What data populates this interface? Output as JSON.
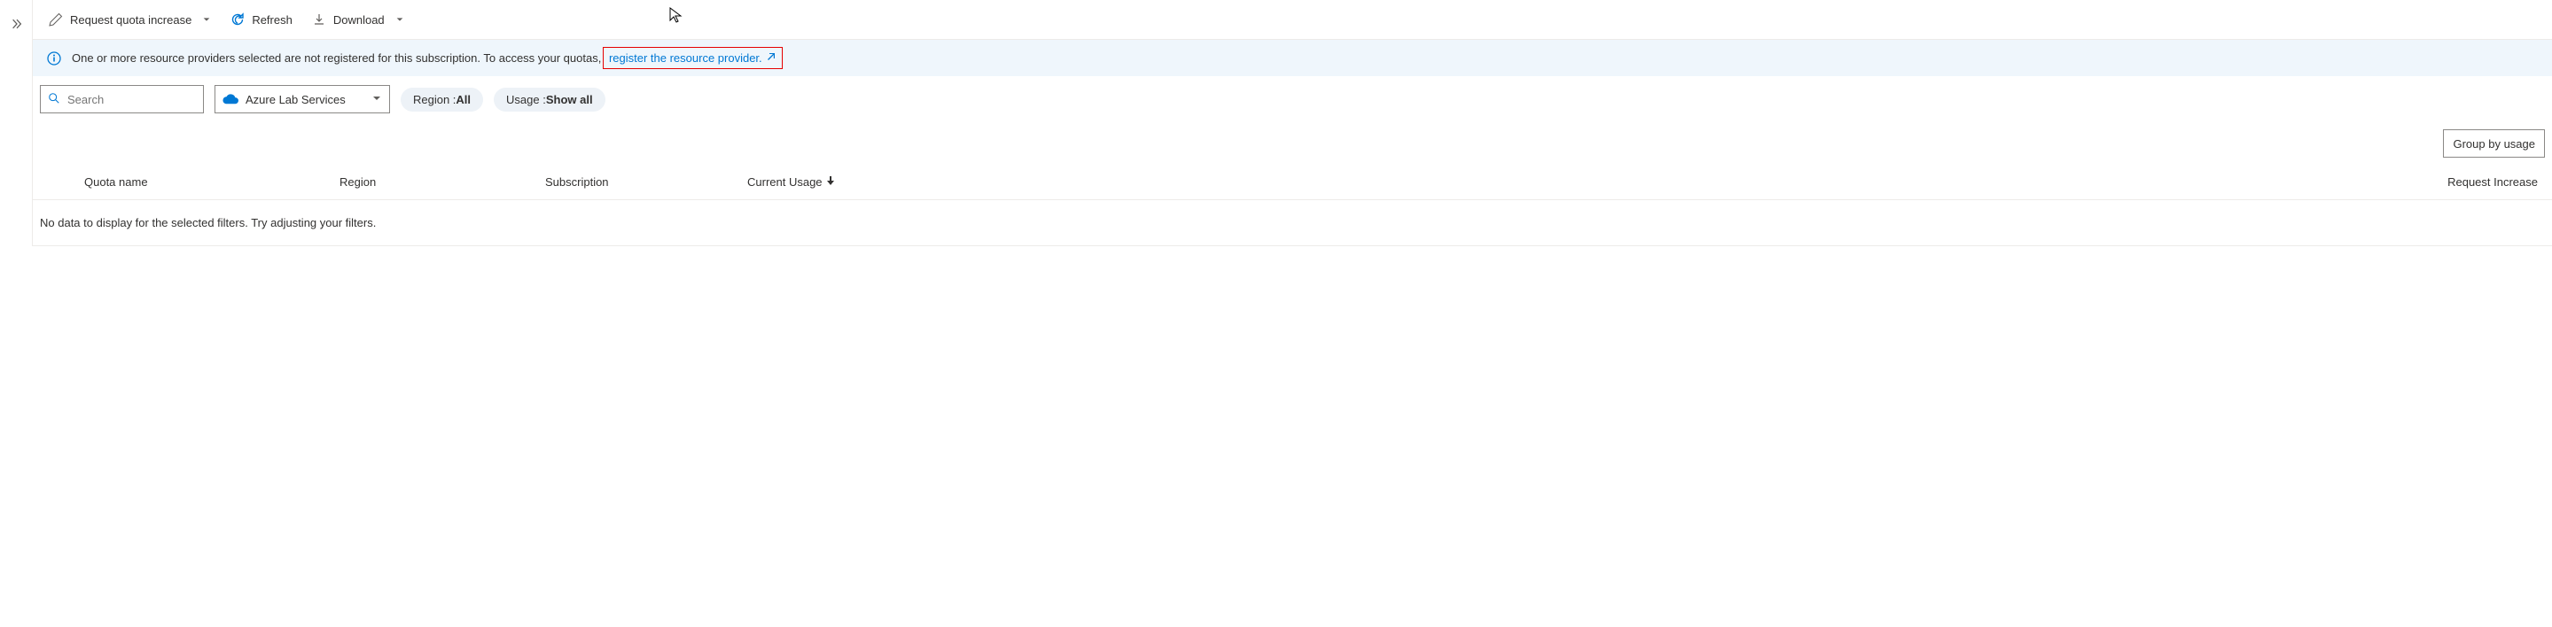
{
  "toolbar": {
    "request_quota_label": "Request quota increase",
    "refresh_label": "Refresh",
    "download_label": "Download"
  },
  "banner": {
    "message": "One or more resource providers selected are not registered for this subscription. To access your quotas,",
    "link_label": "register the resource provider."
  },
  "filters": {
    "search_placeholder": "Search",
    "service_selected": "Azure Lab Services",
    "region_label": "Region : ",
    "region_value": "All",
    "usage_label": "Usage : ",
    "usage_value": "Show all"
  },
  "group_by": {
    "label": "Group by usage"
  },
  "table": {
    "columns": {
      "quota_name": "Quota name",
      "region": "Region",
      "subscription": "Subscription",
      "current_usage": "Current Usage",
      "request_increase": "Request Increase"
    },
    "empty_message": "No data to display for the selected filters. Try adjusting your filters."
  }
}
